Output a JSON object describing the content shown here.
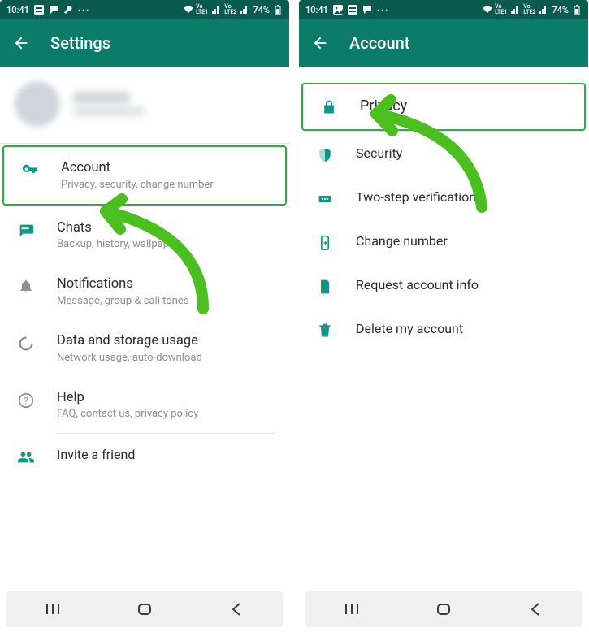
{
  "statusbar": {
    "time": "10:41",
    "battery": "74%",
    "lte1": "LTE1",
    "lte2": "LTE2"
  },
  "left": {
    "title": "Settings",
    "items": {
      "account": {
        "label": "Account",
        "sub": "Privacy, security, change number"
      },
      "chats": {
        "label": "Chats",
        "sub": "Backup, history, wallpaper"
      },
      "notifications": {
        "label": "Notifications",
        "sub": "Message, group & call tones"
      },
      "data": {
        "label": "Data and storage usage",
        "sub": "Network usage, auto-download"
      },
      "help": {
        "label": "Help",
        "sub": "FAQ, contact us, privacy policy"
      },
      "invite": {
        "label": "Invite a friend"
      }
    }
  },
  "right": {
    "title": "Account",
    "items": {
      "privacy": {
        "label": "Privacy"
      },
      "security": {
        "label": "Security"
      },
      "twostep": {
        "label": "Two-step verification"
      },
      "changenum": {
        "label": "Change number"
      },
      "request": {
        "label": "Request account info"
      },
      "delete": {
        "label": "Delete my account"
      }
    }
  }
}
